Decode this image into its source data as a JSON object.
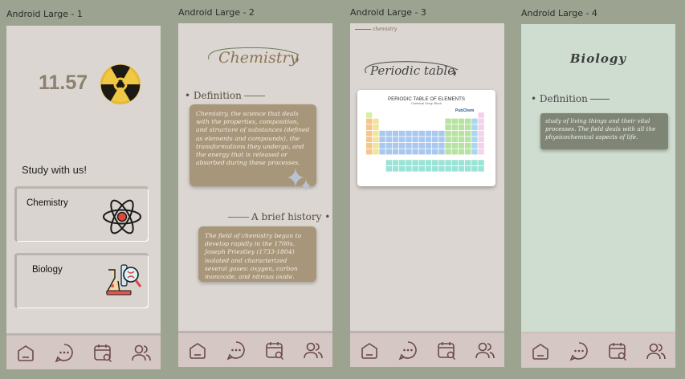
{
  "frames": [
    {
      "title": "Android Large - 1"
    },
    {
      "title": "Android Large - 2"
    },
    {
      "title": "Android Large - 3"
    },
    {
      "title": "Android Large - 4"
    }
  ],
  "screen1": {
    "timer": "11.57",
    "tagline": "Study with us!",
    "subjects": [
      {
        "label": "Chemistry",
        "icon": "atom-icon"
      },
      {
        "label": "Biology",
        "icon": "lab-flask-icon"
      }
    ]
  },
  "screen2": {
    "title": "Chemistry",
    "definition_label": "Definition",
    "definition_text": "Chemistry, the science that deals with the properties, composition, and structure of substances (defined as elements and compounds), the transformations they undergo, and the energy that is released or absorbed during these processes.",
    "history_label": "A brief history",
    "history_text": "The field of chemistry began to develop rapidly in the 1700s. Joseph Priestley (1733-1804) isolated and characterized several gases: oxygen, carbon monoxide, and nitrous oxide."
  },
  "screen3": {
    "breadcrumb": "chemistry",
    "title": "Periodic table",
    "table_title": "PERIODIC TABLE OF ELEMENTS",
    "table_subtitle": "Chemical Group Block",
    "table_brand": "PubChem"
  },
  "screen4": {
    "title": "Biology",
    "definition_label": "Definition",
    "definition_text": "study of living things and their vital processes. The field deals with all the physicochemical aspects of life."
  },
  "nav_icons": [
    "home-icon",
    "chat-icon",
    "calendar-search-icon",
    "users-icon"
  ],
  "colors": {
    "background": "#9da391",
    "phone_bg": "#dbd6d1",
    "phone_bg_bio": "#cfdcd0",
    "navbar": "#d5c7c4",
    "card": "#a8967a",
    "accent_text": "#8a7553"
  }
}
